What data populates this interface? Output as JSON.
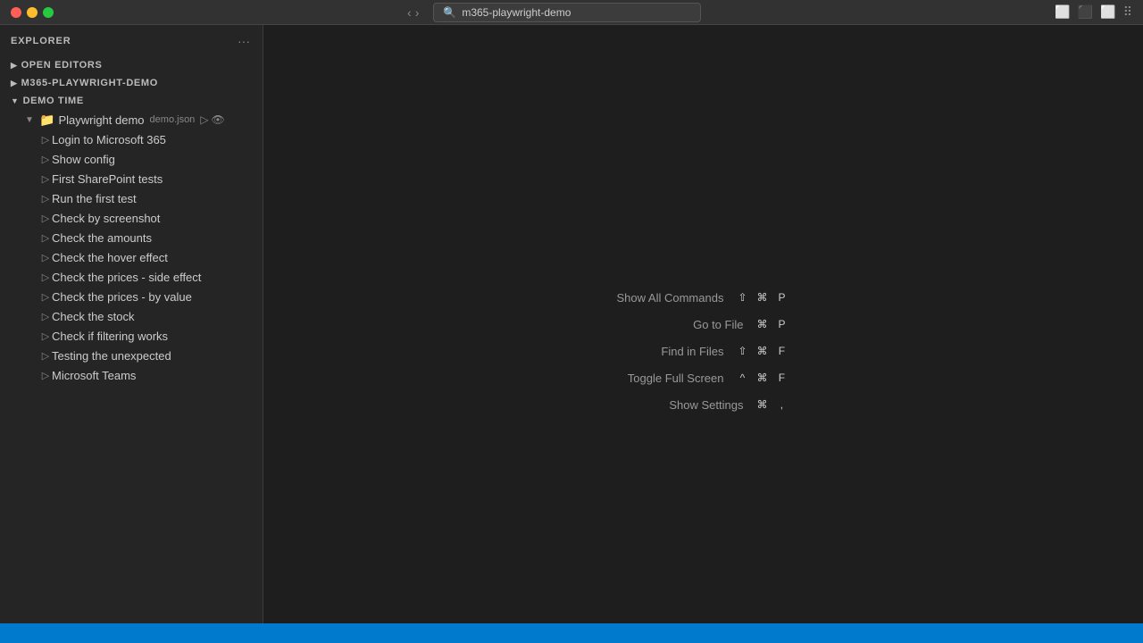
{
  "titlebar": {
    "nav_back": "‹",
    "nav_forward": "›",
    "search_text": "m365-playwright-demo",
    "search_icon": "🔍"
  },
  "sidebar": {
    "title": "Explorer",
    "more_icon": "···",
    "sections": [
      {
        "label": "OPEN EDITORS",
        "expanded": false
      },
      {
        "label": "M365-PLAYWRIGHT-DEMO",
        "expanded": false
      },
      {
        "label": "DEMO TIME",
        "expanded": true
      }
    ],
    "tree": {
      "root": {
        "label": "Playwright demo",
        "badge": "demo.json",
        "icon": "📁",
        "children": [
          {
            "label": "Login to Microsoft 365"
          },
          {
            "label": "Show config"
          },
          {
            "label": "First SharePoint tests"
          },
          {
            "label": "Run the first test"
          },
          {
            "label": "Check by screenshot"
          },
          {
            "label": "Check the amounts"
          },
          {
            "label": "Check the hover effect"
          },
          {
            "label": "Check the prices - side effect"
          },
          {
            "label": "Check the prices - by value"
          },
          {
            "label": "Check the stock"
          },
          {
            "label": "Check if filtering works"
          },
          {
            "label": "Testing the unexpected"
          },
          {
            "label": "Microsoft Teams"
          }
        ]
      }
    }
  },
  "commands": [
    {
      "label": "Show All Commands",
      "keys": [
        "⇧",
        "⌘",
        "P"
      ]
    },
    {
      "label": "Go to File",
      "keys": [
        "⌘",
        "P"
      ]
    },
    {
      "label": "Find in Files",
      "keys": [
        "⇧",
        "⌘",
        "F"
      ]
    },
    {
      "label": "Toggle Full Screen",
      "keys": [
        "^",
        "⌘",
        "F"
      ]
    },
    {
      "label": "Show Settings",
      "keys": [
        "⌘",
        ","
      ]
    }
  ],
  "statusbar": {
    "bg": "#007acc"
  }
}
